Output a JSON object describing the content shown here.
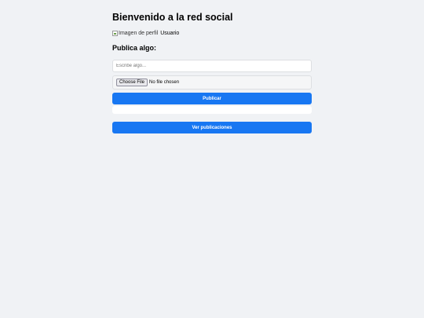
{
  "page": {
    "title": "Bienvenido a la red social"
  },
  "profile": {
    "image_alt": "Imagen de perfil",
    "username": "Usuario"
  },
  "post_form": {
    "heading": "Publica algo:",
    "text_placeholder": "Escribe algo...",
    "file_button_label": "Choose File",
    "file_status": "No file chosen",
    "submit_label": "Publicar"
  },
  "actions": {
    "view_posts_label": "Ver publicaciones"
  },
  "colors": {
    "background": "#f0f2f5",
    "primary": "#1877f2"
  }
}
